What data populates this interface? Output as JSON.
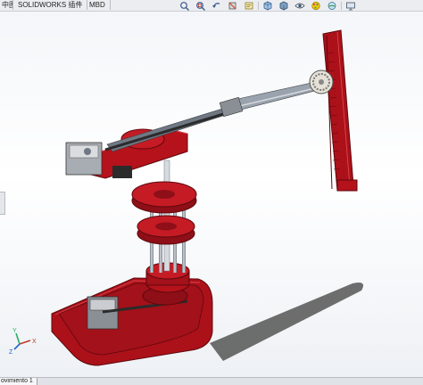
{
  "tabs": [
    {
      "label": "中图"
    },
    {
      "label": "SOLIDWORKS 插件"
    },
    {
      "label": "MBD"
    }
  ],
  "hud_toolbar": [
    {
      "icon": "zoom-to-fit-icon"
    },
    {
      "icon": "zoom-to-area-icon"
    },
    {
      "icon": "previous-view-icon"
    },
    {
      "icon": "section-view-icon"
    },
    {
      "icon": "dynamic-annotation-icon"
    },
    {
      "icon": "view-orientation-icon"
    },
    {
      "icon": "display-style-icon"
    },
    {
      "icon": "hide-show-items-icon"
    },
    {
      "icon": "edit-appearance-icon"
    },
    {
      "icon": "apply-scene-icon"
    },
    {
      "icon": "view-settings-icon"
    }
  ],
  "bottom": {
    "motion_tab_label": "ovimiento 1"
  },
  "triad": {
    "x_label": "X",
    "y_label": "Y",
    "z_label": "Z"
  },
  "colors": {
    "model_red": "#b5121b",
    "model_dark_red": "#7d0c12",
    "rail_grey": "#9aa3ad",
    "belt_black": "#2b2b2b",
    "motor_grey": "#c9ccd0"
  }
}
